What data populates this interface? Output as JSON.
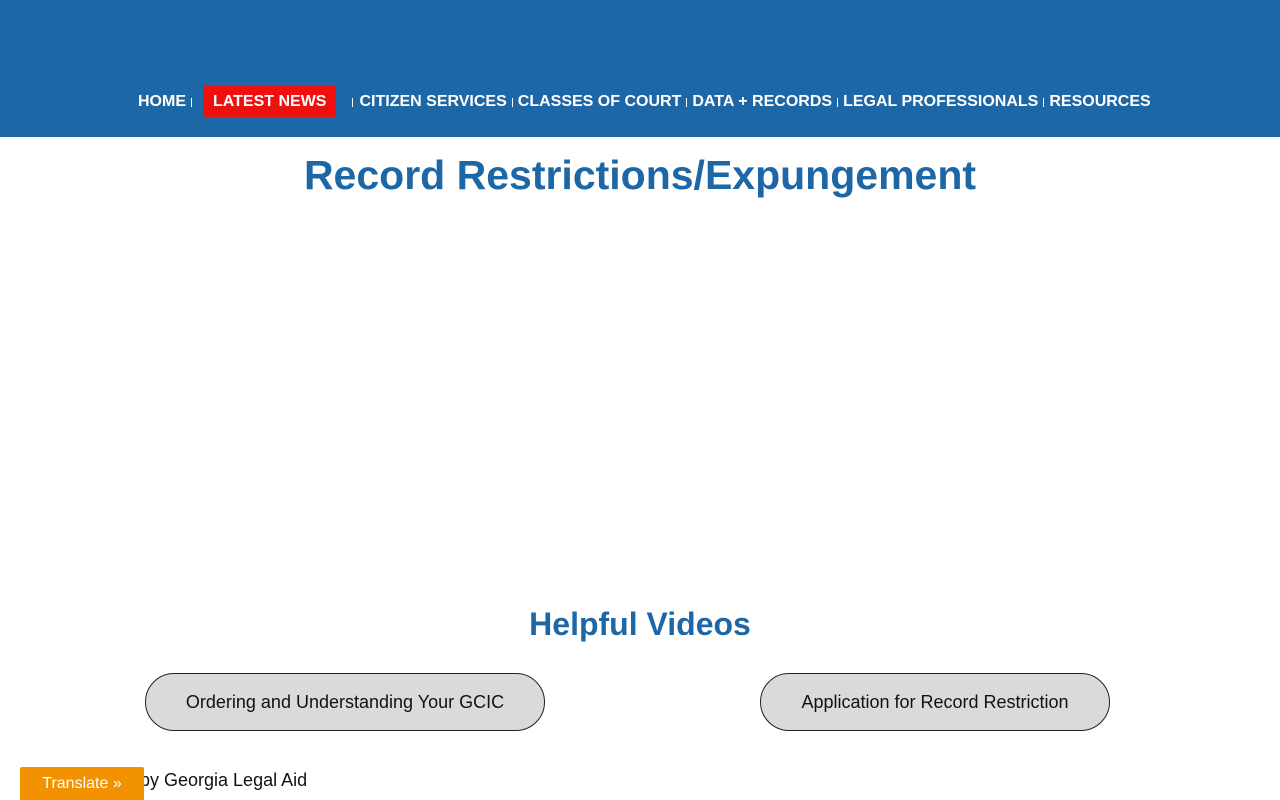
{
  "nav": {
    "items": [
      {
        "label": "HOME"
      },
      {
        "label": "LATEST NEWS"
      },
      {
        "label": "CITIZEN SERVICES"
      },
      {
        "label": "CLASSES OF COURT"
      },
      {
        "label": "DATA + RECORDS"
      },
      {
        "label": "LEGAL PROFESSIONALS"
      },
      {
        "label": "RESOURCES"
      }
    ],
    "active_item": "LATEST NEWS",
    "accent_color": "#ee0f0f",
    "bar_color": "#1e67a6"
  },
  "page": {
    "title": "Record Restrictions/Expungement"
  },
  "videos": {
    "section_title": "Helpful Videos",
    "buttons": [
      {
        "label": "Ordering and Understanding Your GCIC"
      },
      {
        "label": "Application for Record Restriction"
      }
    ]
  },
  "footer": {
    "credit_text": "by Georgia Legal Aid",
    "translate_label": "Translate »",
    "translate_color": "#f39200"
  }
}
